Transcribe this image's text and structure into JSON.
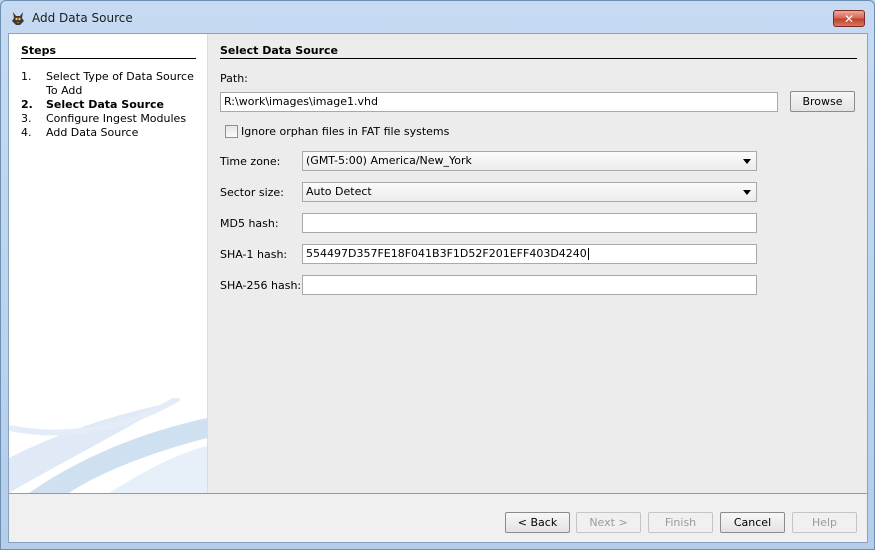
{
  "window": {
    "title": "Add Data Source",
    "close_glyph": "✕"
  },
  "steps": {
    "heading": "Steps",
    "items": [
      {
        "num": "1.",
        "label": "Select Type of Data Source To Add"
      },
      {
        "num": "2.",
        "label": "Select Data Source"
      },
      {
        "num": "3.",
        "label": "Configure Ingest Modules"
      },
      {
        "num": "4.",
        "label": "Add Data Source"
      }
    ],
    "current_index": 1
  },
  "panel": {
    "title": "Select Data Source",
    "path_label": "Path:",
    "path_value": "R:\\work\\images\\image1.vhd",
    "browse_label": "Browse",
    "ignore_orphan_label": "Ignore orphan files in FAT file systems",
    "ignore_orphan_checked": false,
    "timezone_label": "Time zone:",
    "timezone_value": "(GMT-5:00) America/New_York",
    "sector_label": "Sector size:",
    "sector_value": "Auto Detect",
    "md5_label": "MD5 hash:",
    "md5_value": "",
    "sha1_label": "SHA-1 hash:",
    "sha1_value": "554497D357FE18F041B3F1D52F201EFF403D4240",
    "sha256_label": "SHA-256 hash:",
    "sha256_value": ""
  },
  "footer": {
    "back_label": "< Back",
    "next_label": "Next >",
    "finish_label": "Finish",
    "cancel_label": "Cancel",
    "help_label": "Help"
  }
}
